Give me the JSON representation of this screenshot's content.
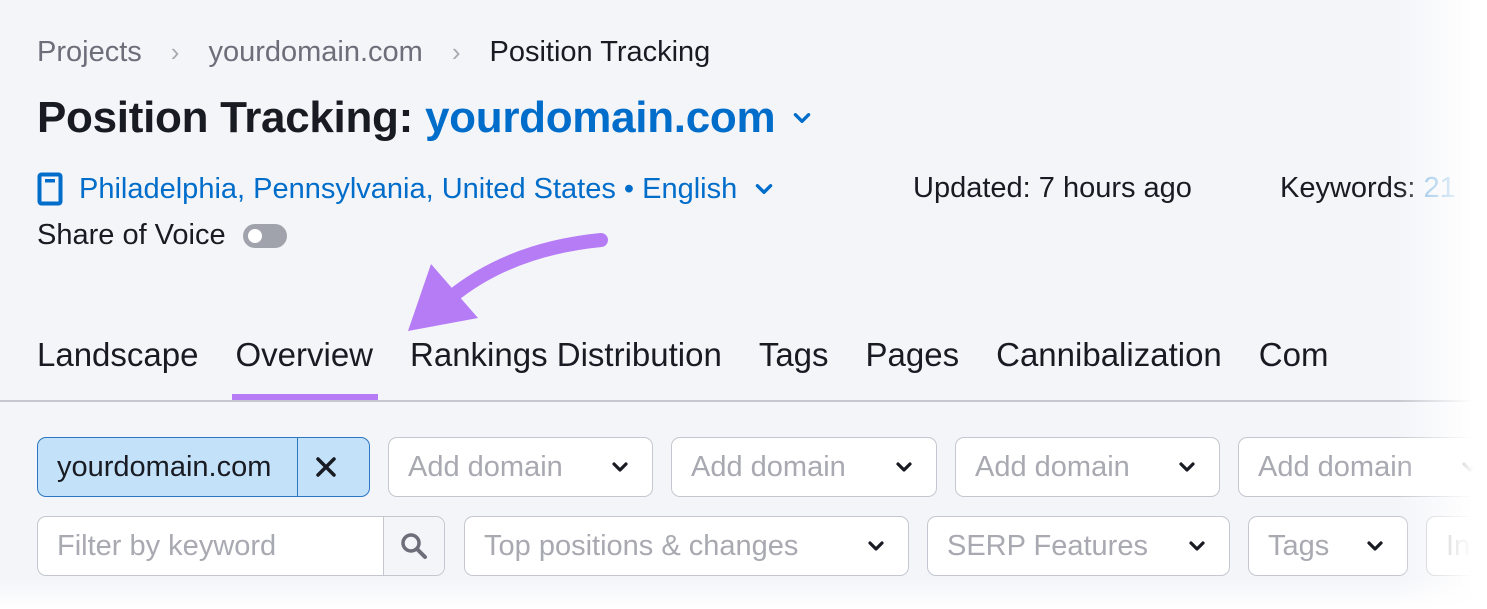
{
  "breadcrumb": {
    "items": [
      "Projects",
      "yourdomain.com",
      "Position Tracking"
    ],
    "separator": "›"
  },
  "header": {
    "title_prefix": "Position Tracking:",
    "title_domain": "yourdomain.com"
  },
  "meta": {
    "location": "Philadelphia, Pennsylvania, United States • English",
    "device_icon": "mobile-device-icon",
    "updated": "Updated: 7 hours ago",
    "keywords_label": "Keywords:",
    "keywords_value": "21"
  },
  "share_of_voice": {
    "label": "Share of Voice",
    "enabled": false
  },
  "tabs": [
    {
      "label": "Landscape",
      "active": false
    },
    {
      "label": "Overview",
      "active": true
    },
    {
      "label": "Rankings Distribution",
      "active": false
    },
    {
      "label": "Tags",
      "active": false
    },
    {
      "label": "Pages",
      "active": false
    },
    {
      "label": "Cannibalization",
      "active": false
    },
    {
      "label": "Com",
      "active": false
    }
  ],
  "domains": {
    "selected": "yourdomain.com",
    "add_placeholders": [
      "Add domain",
      "Add domain",
      "Add domain",
      "Add domain"
    ]
  },
  "filters": {
    "keyword_placeholder": "Filter by keyword",
    "dropdowns": [
      "Top positions & changes",
      "SERP Features",
      "Tags",
      "In"
    ]
  },
  "annotation": {
    "arrow_color": "#b57cf6",
    "points_to": "Overview"
  },
  "colors": {
    "accent_blue": "#006dca",
    "active_tab_underline": "#b57cf6",
    "chip_background": "#c3e1f9"
  }
}
